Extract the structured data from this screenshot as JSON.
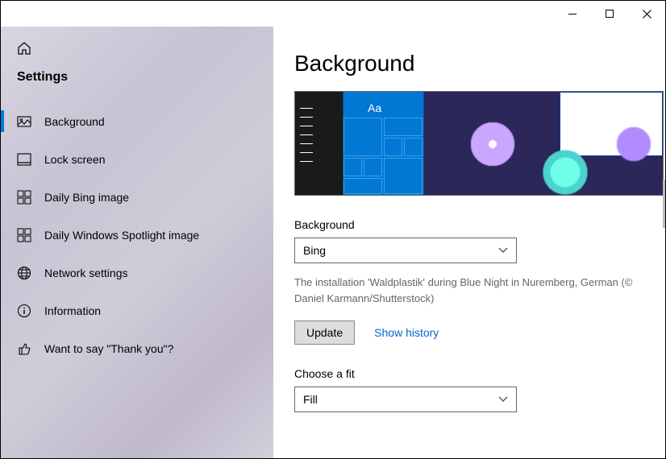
{
  "sidebar": {
    "title": "Settings",
    "items": [
      {
        "label": "Background",
        "icon": "image-icon",
        "active": true
      },
      {
        "label": "Lock screen",
        "icon": "lockscreen-icon",
        "active": false
      },
      {
        "label": "Daily Bing image",
        "icon": "grid-icon",
        "active": false
      },
      {
        "label": "Daily Windows Spotlight image",
        "icon": "grid-icon",
        "active": false
      },
      {
        "label": "Network settings",
        "icon": "globe-icon",
        "active": false
      },
      {
        "label": "Information",
        "icon": "info-icon",
        "active": false
      },
      {
        "label": "Want to say \"Thank you\"?",
        "icon": "thumbsup-icon",
        "active": false
      }
    ]
  },
  "main": {
    "title": "Background",
    "preview_sample_text": "Aa",
    "background_label": "Background",
    "background_value": "Bing",
    "caption": "The installation 'Waldplastik' during Blue Night in Nuremberg, German (© Daniel Karmann/Shutterstock)",
    "update_label": "Update",
    "history_label": "Show history",
    "fit_label": "Choose a fit",
    "fit_value": "Fill"
  }
}
